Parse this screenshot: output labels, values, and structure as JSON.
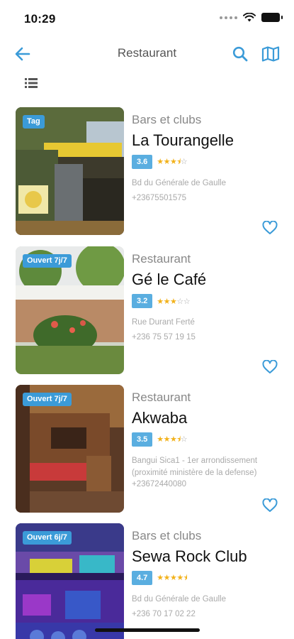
{
  "status": {
    "time": "10:29"
  },
  "nav": {
    "title": "Restaurant"
  },
  "colors": {
    "accent": "#3b9bd8",
    "rating": "#5aaee0",
    "star": "#f2b21b"
  },
  "listings": [
    {
      "badge": "Tag",
      "category": "Bars et clubs",
      "name": "La Tourangelle",
      "rating": "3.6",
      "stars": 3.5,
      "address": "Bd du Générale de Gaulle",
      "phone": "+23675501575"
    },
    {
      "badge": "Ouvert 7j/7",
      "category": "Restaurant",
      "name": "Gé le Café",
      "rating": "3.2",
      "stars": 3,
      "address": "Rue Durant Ferté",
      "phone": "+236 75 57 19 15"
    },
    {
      "badge": "Ouvert 7j/7",
      "category": "Restaurant",
      "name": "Akwaba",
      "rating": "3.5",
      "stars": 3.5,
      "address": "Bangui Sica1 - 1er arrondissement (proximité ministère de la defense)",
      "phone": "+23672440080"
    },
    {
      "badge": "Ouvert 6j/7",
      "category": "Bars et clubs",
      "name": "Sewa Rock Club",
      "rating": "4.7",
      "stars": 4.5,
      "address": "Bd du Générale de Gaulle",
      "phone": "+236 70 17 02 22"
    }
  ]
}
